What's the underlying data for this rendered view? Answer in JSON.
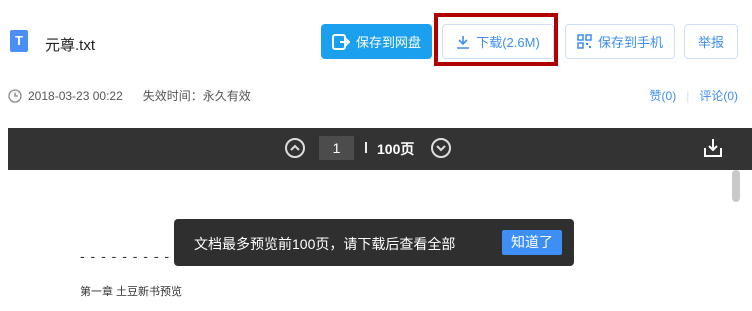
{
  "file": {
    "icon_letter": "T",
    "name": "元尊.txt"
  },
  "actions": {
    "save_to_drive": "保存到网盘",
    "download": "下载(2.6M)",
    "save_to_phone": "保存到手机",
    "report": "举报"
  },
  "meta": {
    "date": "2018-03-23 00:22",
    "expiry": "失效时间：永久有效",
    "likes": "赞(0)",
    "comments": "评论(0)"
  },
  "viewer": {
    "current_page": "1",
    "total_pages": "100页"
  },
  "tip": {
    "text": "文档最多预览前100页，请下载后查看全部",
    "button": "知道了"
  },
  "document": {
    "dashes": "- - - - - - - - - - - -",
    "line1": "第一章  土豆新书预览"
  },
  "colors": {
    "accent": "#1aa0ef",
    "link": "#3e8df0",
    "toolbar": "#333333",
    "highlight": "#b00000"
  }
}
